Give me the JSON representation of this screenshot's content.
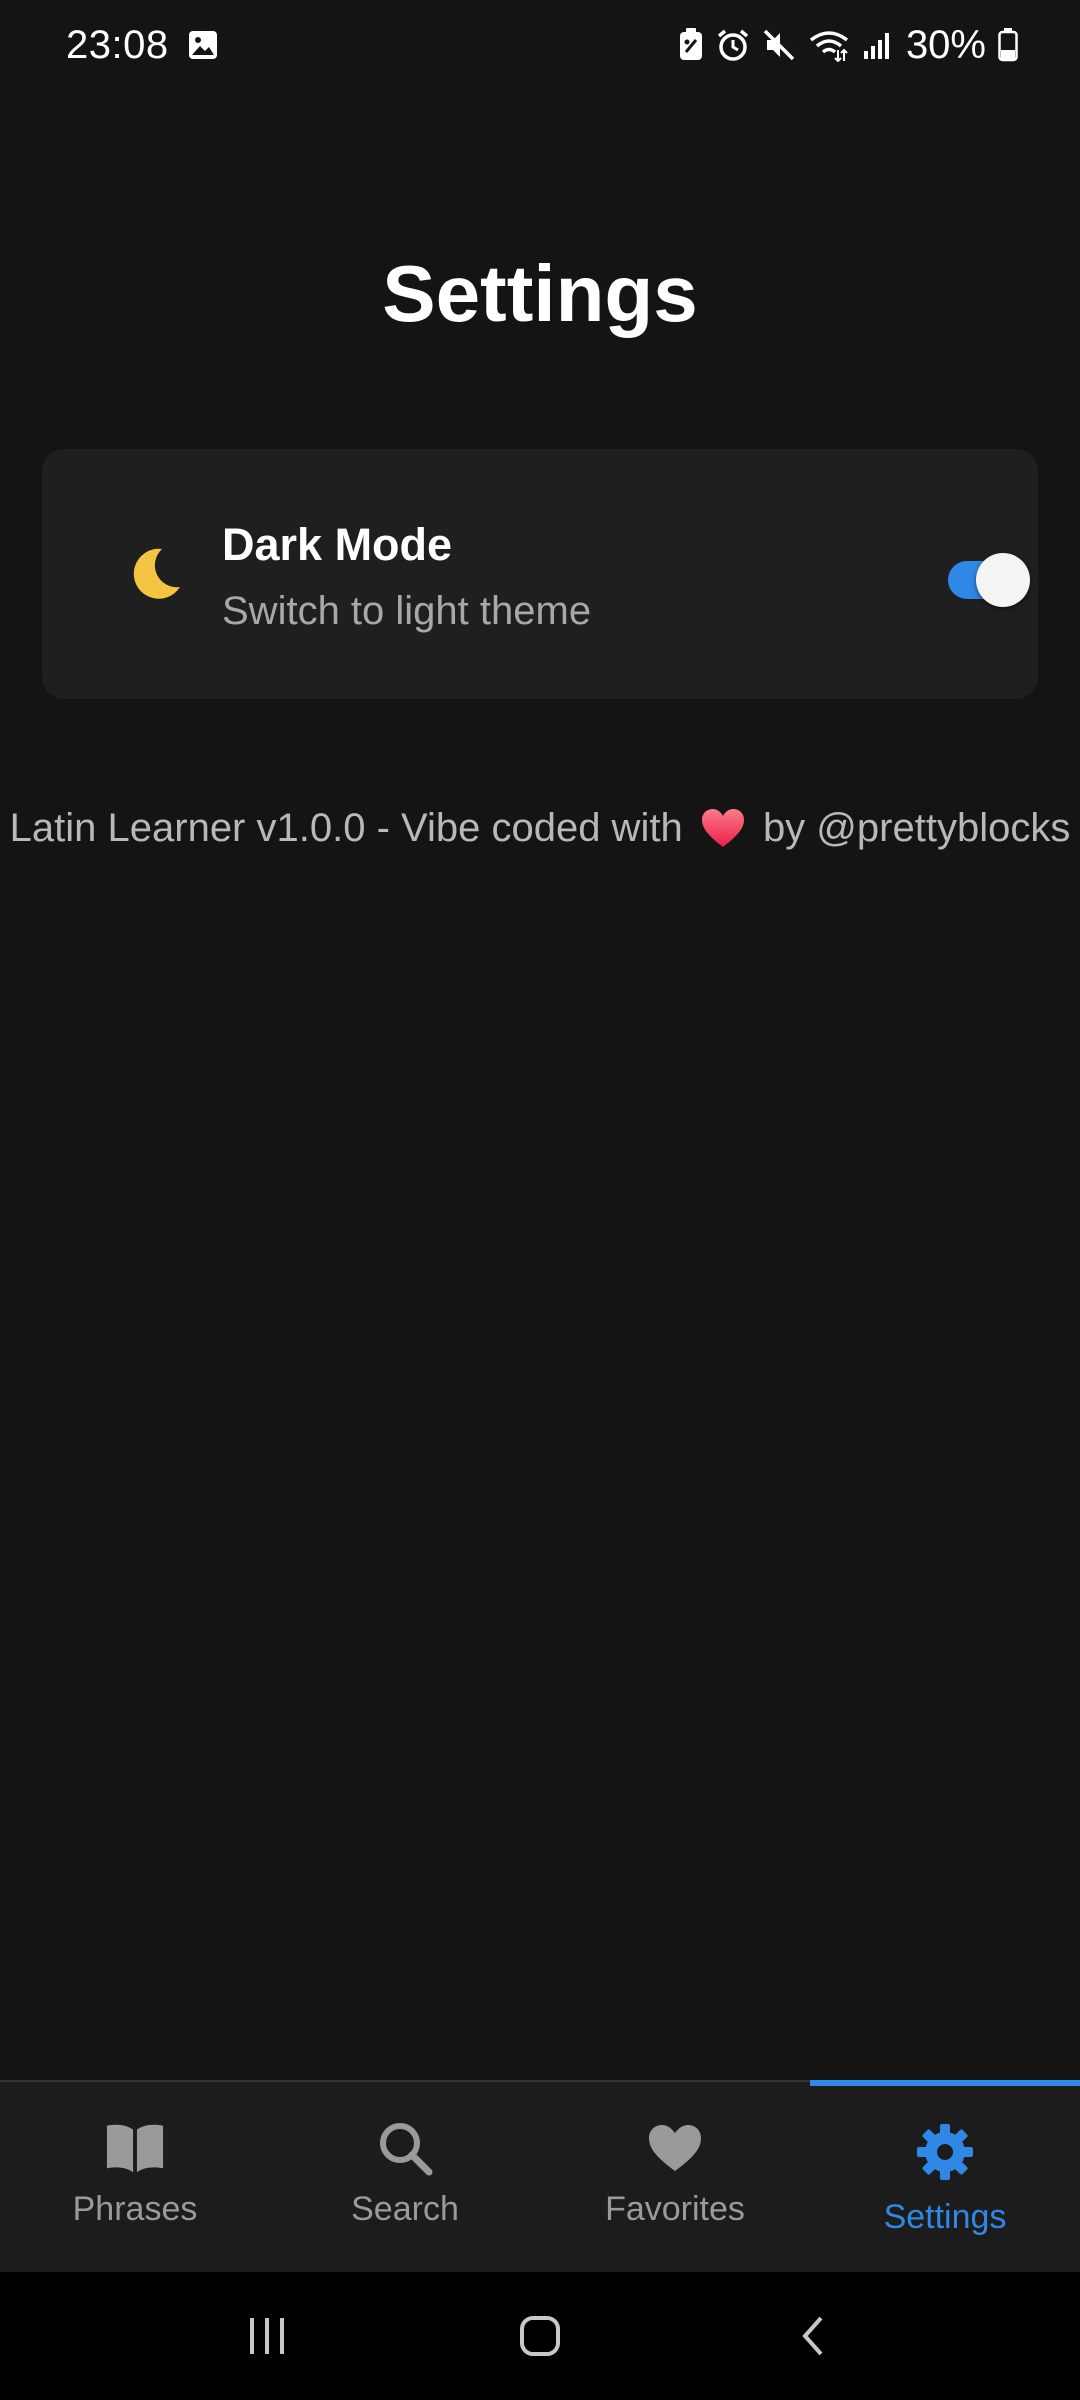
{
  "status_bar": {
    "time": "23:08",
    "battery": "30%",
    "icons": [
      "image-icon",
      "battery-saver-icon",
      "alarm-icon",
      "mute-icon",
      "wifi-icon",
      "signal-icon",
      "battery-icon"
    ]
  },
  "page": {
    "title": "Settings"
  },
  "settings": {
    "dark_mode": {
      "icon": "moon-icon",
      "title": "Dark Mode",
      "subtitle": "Switch to light theme",
      "enabled": true
    }
  },
  "credit": {
    "prefix": "Latin Learner v1.0.0 - Vibe coded with",
    "suffix": "by @prettyblocks",
    "icon": "heart-icon"
  },
  "tabs": [
    {
      "label": "Phrases",
      "icon": "book-icon",
      "active": false
    },
    {
      "label": "Search",
      "icon": "search-icon",
      "active": false
    },
    {
      "label": "Favorites",
      "icon": "heart-icon",
      "active": false
    },
    {
      "label": "Settings",
      "icon": "gear-icon",
      "active": true
    }
  ],
  "colors": {
    "background": "#141414",
    "card": "#1f1f1f",
    "accent": "#2f87e6",
    "moon": "#f6c443",
    "heart": "#ff4f6d",
    "inactive_tab": "#9a9a9a"
  },
  "system_nav": [
    "recents-button",
    "home-button",
    "back-button"
  ]
}
